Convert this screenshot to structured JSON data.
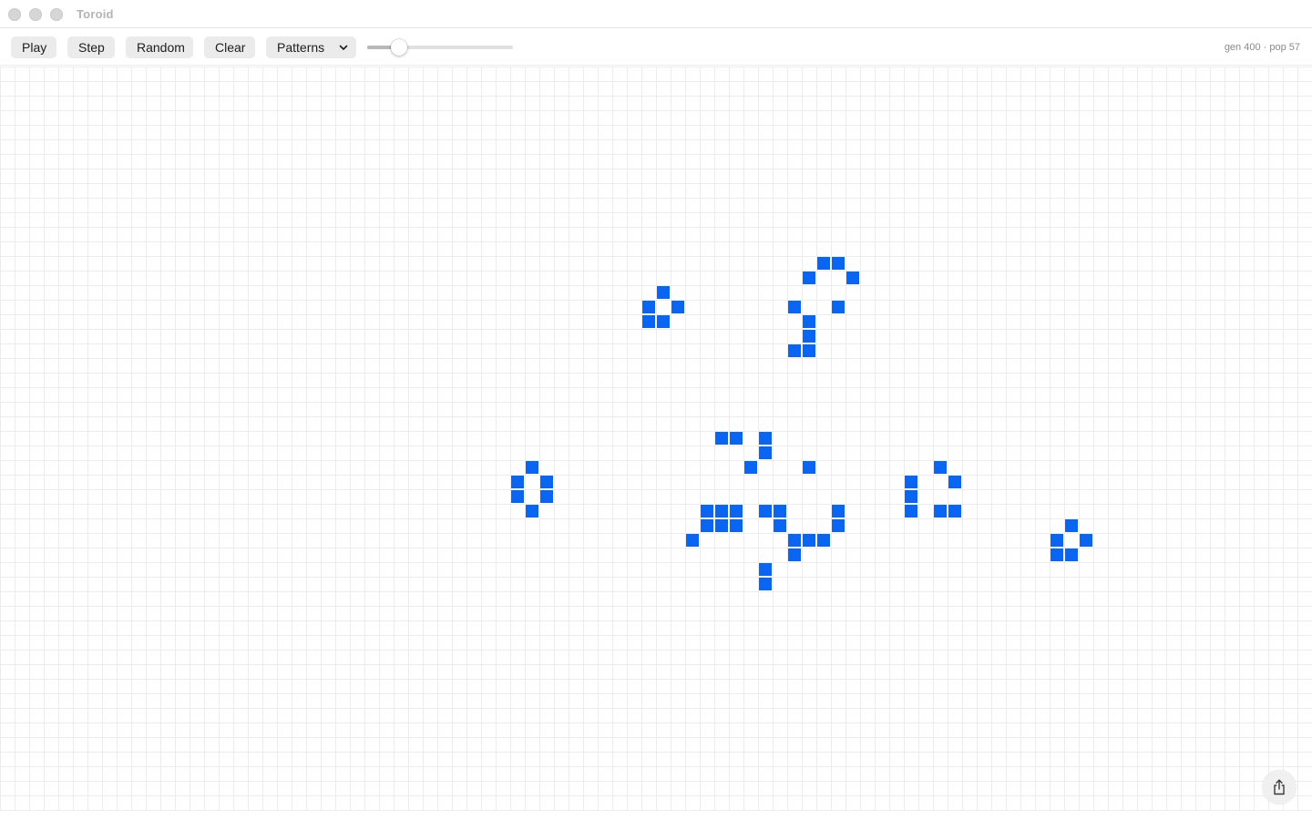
{
  "window": {
    "title": "Toroid"
  },
  "toolbar": {
    "play_label": "Play",
    "step_label": "Step",
    "random_label": "Random",
    "clear_label": "Clear",
    "patterns": {
      "selected": "Patterns",
      "icon": "chevron-down-icon"
    },
    "speed": {
      "value": 0.22
    },
    "status": "gen 400 · pop 57"
  },
  "board": {
    "cell_color": "#0a66f0",
    "grid_color": "#ececec",
    "live_cells": [
      [
        56,
        13
      ],
      [
        57,
        13
      ],
      [
        55,
        14
      ],
      [
        58,
        14
      ],
      [
        45,
        15
      ],
      [
        44,
        16
      ],
      [
        46,
        16
      ],
      [
        54,
        16
      ],
      [
        57,
        16
      ],
      [
        44,
        17
      ],
      [
        45,
        17
      ],
      [
        55,
        17
      ],
      [
        55,
        18
      ],
      [
        54,
        19
      ],
      [
        55,
        19
      ],
      [
        49,
        25
      ],
      [
        50,
        25
      ],
      [
        52,
        25
      ],
      [
        52,
        26
      ],
      [
        51,
        27
      ],
      [
        55,
        27
      ],
      [
        36,
        27
      ],
      [
        64,
        27
      ],
      [
        35,
        28
      ],
      [
        37,
        28
      ],
      [
        62,
        28
      ],
      [
        65,
        28
      ],
      [
        35,
        29
      ],
      [
        37,
        29
      ],
      [
        62,
        29
      ],
      [
        36,
        30
      ],
      [
        48,
        30
      ],
      [
        49,
        30
      ],
      [
        50,
        30
      ],
      [
        52,
        30
      ],
      [
        53,
        30
      ],
      [
        57,
        30
      ],
      [
        62,
        30
      ],
      [
        64,
        30
      ],
      [
        65,
        30
      ],
      [
        48,
        31
      ],
      [
        49,
        31
      ],
      [
        50,
        31
      ],
      [
        53,
        31
      ],
      [
        57,
        31
      ],
      [
        73,
        31
      ],
      [
        47,
        32
      ],
      [
        54,
        32
      ],
      [
        55,
        32
      ],
      [
        56,
        32
      ],
      [
        72,
        32
      ],
      [
        74,
        32
      ],
      [
        54,
        33
      ],
      [
        72,
        33
      ],
      [
        73,
        33
      ],
      [
        52,
        34
      ],
      [
        52,
        35
      ]
    ]
  },
  "share": {
    "icon": "share-icon"
  }
}
